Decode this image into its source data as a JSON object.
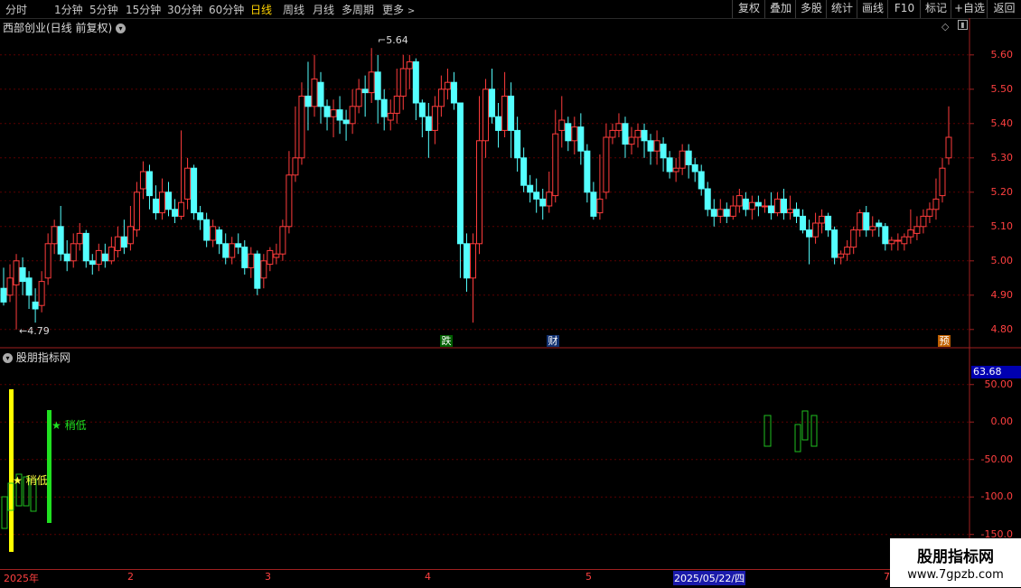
{
  "toolbar": {
    "periods": [
      "分时",
      "1分钟",
      "5分钟",
      "15分钟",
      "30分钟",
      "60分钟",
      "日线",
      "周线",
      "月线",
      "多周期",
      "更多"
    ],
    "active": "日线",
    "right_buttons": [
      "复权",
      "叠加",
      "多股",
      "统计",
      "画线",
      "F10",
      "标记",
      "+自选",
      "返回"
    ]
  },
  "main_pane": {
    "title": "西部创业(日线 前复权)",
    "price_axis": [
      "5.60",
      "5.50",
      "5.40",
      "5.30",
      "5.20",
      "5.10",
      "5.00",
      "4.90",
      "4.80"
    ],
    "high_label": "5.64",
    "low_label": "4.79",
    "event_tags": [
      {
        "text": "跌",
        "color": "#00a000"
      },
      {
        "text": "财",
        "color": "#2060d0"
      },
      {
        "text": "预",
        "color": "#e07000"
      }
    ]
  },
  "sub_pane": {
    "title": "股朋指标网",
    "current_value": "63.68",
    "axis": [
      "50.00",
      "0.00",
      "-50.00",
      "-100.0",
      "-150.0"
    ],
    "signal_label_1": "★ 稍低",
    "signal_label_2": "★ 稍低"
  },
  "date_axis": [
    "2025年",
    "2",
    "3",
    "4",
    "5",
    "2025/05/22/四",
    "7"
  ],
  "watermark": {
    "title": "股朋指标网",
    "url": "www.7gpzb.com"
  },
  "colors": {
    "up": "#ff3c3c",
    "down": "#54ffff",
    "grid": "#5a0000",
    "axis": "#a02020"
  },
  "chart_data": {
    "type": "candlestick",
    "symbol": "西部创业",
    "period": "日线",
    "ylim": [
      4.76,
      5.66
    ],
    "high_marker": 5.64,
    "low_marker": 4.79,
    "candles": [
      [
        4.92,
        4.88,
        4.98,
        4.87
      ],
      [
        4.9,
        4.95,
        4.99,
        4.88
      ],
      [
        4.93,
        5.0,
        5.02,
        4.8
      ],
      [
        4.98,
        4.94,
        5.01,
        4.9
      ],
      [
        4.95,
        4.9,
        4.97,
        4.86
      ],
      [
        4.88,
        4.86,
        4.92,
        4.82
      ],
      [
        4.87,
        4.94,
        4.97,
        4.85
      ],
      [
        4.95,
        5.05,
        5.08,
        4.93
      ],
      [
        5.05,
        5.1,
        5.12,
        5.02
      ],
      [
        5.1,
        5.02,
        5.16,
        5.0
      ],
      [
        5.02,
        5.0,
        5.06,
        4.97
      ],
      [
        5.0,
        5.05,
        5.08,
        4.98
      ],
      [
        5.05,
        5.08,
        5.11,
        5.03
      ],
      [
        5.08,
        5.0,
        5.09,
        4.98
      ],
      [
        5.0,
        4.99,
        5.02,
        4.96
      ],
      [
        4.99,
        5.03,
        5.05,
        4.97
      ],
      [
        5.02,
        5.0,
        5.05,
        4.98
      ],
      [
        5.0,
        5.04,
        5.07,
        4.99
      ],
      [
        5.03,
        5.07,
        5.1,
        5.01
      ],
      [
        5.07,
        5.04,
        5.12,
        5.02
      ],
      [
        5.05,
        5.1,
        5.16,
        5.03
      ],
      [
        5.09,
        5.2,
        5.23,
        5.07
      ],
      [
        5.21,
        5.26,
        5.29,
        5.18
      ],
      [
        5.26,
        5.19,
        5.28,
        5.15
      ],
      [
        5.18,
        5.14,
        5.22,
        5.12
      ],
      [
        5.14,
        5.2,
        5.24,
        5.12
      ],
      [
        5.2,
        5.15,
        5.23,
        5.13
      ],
      [
        5.15,
        5.13,
        5.18,
        5.11
      ],
      [
        5.13,
        5.17,
        5.38,
        5.12
      ],
      [
        5.18,
        5.27,
        5.3,
        5.15
      ],
      [
        5.27,
        5.14,
        5.28,
        5.12
      ],
      [
        5.14,
        5.12,
        5.16,
        5.09
      ],
      [
        5.12,
        5.06,
        5.14,
        5.04
      ],
      [
        5.06,
        5.1,
        5.12,
        5.04
      ],
      [
        5.09,
        5.05,
        5.1,
        5.02
      ],
      [
        5.05,
        5.01,
        5.08,
        4.99
      ],
      [
        5.01,
        5.05,
        5.07,
        4.99
      ],
      [
        5.05,
        5.04,
        5.08,
        5.02
      ],
      [
        5.04,
        4.98,
        5.06,
        4.96
      ],
      [
        4.98,
        5.02,
        5.04,
        4.95
      ],
      [
        5.02,
        4.92,
        5.03,
        4.9
      ],
      [
        4.95,
        5.0,
        5.02,
        4.92
      ],
      [
        4.99,
        5.03,
        5.04,
        4.97
      ],
      [
        5.01,
        5.02,
        5.05,
        4.99
      ],
      [
        5.02,
        5.1,
        5.12,
        5.0
      ],
      [
        5.1,
        5.25,
        5.32,
        5.08
      ],
      [
        5.25,
        5.3,
        5.45,
        5.23
      ],
      [
        5.3,
        5.48,
        5.52,
        5.28
      ],
      [
        5.48,
        5.45,
        5.58,
        5.38
      ],
      [
        5.45,
        5.53,
        5.6,
        5.42
      ],
      [
        5.52,
        5.45,
        5.55,
        5.4
      ],
      [
        5.45,
        5.42,
        5.47,
        5.38
      ],
      [
        5.42,
        5.44,
        5.47,
        5.36
      ],
      [
        5.44,
        5.41,
        5.48,
        5.37
      ],
      [
        5.41,
        5.4,
        5.44,
        5.35
      ],
      [
        5.4,
        5.45,
        5.5,
        5.37
      ],
      [
        5.45,
        5.5,
        5.53,
        5.43
      ],
      [
        5.5,
        5.49,
        5.54,
        5.42
      ],
      [
        5.49,
        5.55,
        5.62,
        5.46
      ],
      [
        5.55,
        5.47,
        5.6,
        5.4
      ],
      [
        5.47,
        5.42,
        5.5,
        5.38
      ],
      [
        5.41,
        5.43,
        5.47,
        5.38
      ],
      [
        5.43,
        5.48,
        5.56,
        5.4
      ],
      [
        5.48,
        5.56,
        5.6,
        5.44
      ],
      [
        5.56,
        5.58,
        5.6,
        5.5
      ],
      [
        5.58,
        5.46,
        5.59,
        5.41
      ],
      [
        5.46,
        5.42,
        5.47,
        5.36
      ],
      [
        5.42,
        5.38,
        5.46,
        5.3
      ],
      [
        5.38,
        5.45,
        5.48,
        5.34
      ],
      [
        5.45,
        5.5,
        5.54,
        5.42
      ],
      [
        5.5,
        5.52,
        5.56,
        5.47
      ],
      [
        5.52,
        5.46,
        5.55,
        5.44
      ],
      [
        5.46,
        5.05,
        5.2,
        4.95
      ],
      [
        5.05,
        4.95,
        5.08,
        4.91
      ],
      [
        4.95,
        5.05,
        5.08,
        4.82
      ],
      [
        5.05,
        5.35,
        5.48,
        5.02
      ],
      [
        5.35,
        5.5,
        5.53,
        5.3
      ],
      [
        5.5,
        5.42,
        5.56,
        5.4
      ],
      [
        5.42,
        5.38,
        5.46,
        5.33
      ],
      [
        5.38,
        5.48,
        5.55,
        5.36
      ],
      [
        5.48,
        5.38,
        5.52,
        5.3
      ],
      [
        5.38,
        5.3,
        5.42,
        5.26
      ],
      [
        5.3,
        5.22,
        5.33,
        5.2
      ],
      [
        5.22,
        5.2,
        5.25,
        5.17
      ],
      [
        5.2,
        5.18,
        5.24,
        5.14
      ],
      [
        5.18,
        5.16,
        5.21,
        5.12
      ],
      [
        5.16,
        5.2,
        5.26,
        5.14
      ],
      [
        5.19,
        5.37,
        5.44,
        5.17
      ],
      [
        5.38,
        5.41,
        5.48,
        5.33
      ],
      [
        5.4,
        5.35,
        5.42,
        5.32
      ],
      [
        5.35,
        5.39,
        5.42,
        5.31
      ],
      [
        5.39,
        5.32,
        5.43,
        5.28
      ],
      [
        5.32,
        5.2,
        5.34,
        5.17
      ],
      [
        5.2,
        5.13,
        5.23,
        5.12
      ],
      [
        5.14,
        5.18,
        5.31,
        5.12
      ],
      [
        5.2,
        5.36,
        5.4,
        5.18
      ],
      [
        5.36,
        5.38,
        5.4,
        5.34
      ],
      [
        5.38,
        5.4,
        5.43,
        5.36
      ],
      [
        5.4,
        5.34,
        5.42,
        5.3
      ],
      [
        5.34,
        5.36,
        5.39,
        5.31
      ],
      [
        5.36,
        5.38,
        5.4,
        5.33
      ],
      [
        5.38,
        5.35,
        5.4,
        5.3
      ],
      [
        5.35,
        5.32,
        5.37,
        5.28
      ],
      [
        5.32,
        5.35,
        5.38,
        5.28
      ],
      [
        5.34,
        5.3,
        5.36,
        5.26
      ],
      [
        5.3,
        5.26,
        5.32,
        5.24
      ],
      [
        5.26,
        5.27,
        5.3,
        5.23
      ],
      [
        5.27,
        5.32,
        5.34,
        5.25
      ],
      [
        5.32,
        5.28,
        5.34,
        5.24
      ],
      [
        5.28,
        5.26,
        5.3,
        5.23
      ],
      [
        5.26,
        5.21,
        5.28,
        5.19
      ],
      [
        5.21,
        5.15,
        5.23,
        5.13
      ],
      [
        5.15,
        5.13,
        5.18,
        5.1
      ],
      [
        5.13,
        5.15,
        5.18,
        5.11
      ],
      [
        5.15,
        5.13,
        5.17,
        5.11
      ],
      [
        5.13,
        5.16,
        5.19,
        5.12
      ],
      [
        5.16,
        5.19,
        5.21,
        5.14
      ],
      [
        5.18,
        5.15,
        5.2,
        5.13
      ],
      [
        5.15,
        5.17,
        5.19,
        5.12
      ],
      [
        5.17,
        5.16,
        5.19,
        5.13
      ],
      [
        5.16,
        5.16,
        5.18,
        5.14
      ],
      [
        5.16,
        5.14,
        5.2,
        5.12
      ],
      [
        5.14,
        5.18,
        5.2,
        5.13
      ],
      [
        5.18,
        5.14,
        5.21,
        5.12
      ],
      [
        5.14,
        5.15,
        5.19,
        5.12
      ],
      [
        5.15,
        5.13,
        5.17,
        5.11
      ],
      [
        5.13,
        5.09,
        5.15,
        5.08
      ],
      [
        5.09,
        5.07,
        5.12,
        4.99
      ],
      [
        5.07,
        5.11,
        5.14,
        5.05
      ],
      [
        5.11,
        5.13,
        5.15,
        5.08
      ],
      [
        5.13,
        5.09,
        5.14,
        5.07
      ],
      [
        5.09,
        5.01,
        5.1,
        4.99
      ],
      [
        5.01,
        5.02,
        5.03,
        4.99
      ],
      [
        5.02,
        5.04,
        5.06,
        5.0
      ],
      [
        5.04,
        5.09,
        5.1,
        5.02
      ],
      [
        5.09,
        5.14,
        5.15,
        5.07
      ],
      [
        5.14,
        5.09,
        5.16,
        5.07
      ],
      [
        5.09,
        5.1,
        5.13,
        5.07
      ],
      [
        5.11,
        5.1,
        5.12,
        5.07
      ],
      [
        5.1,
        5.05,
        5.11,
        5.03
      ],
      [
        5.05,
        5.06,
        5.07,
        5.03
      ],
      [
        5.06,
        5.06,
        5.08,
        5.03
      ],
      [
        5.05,
        5.07,
        5.08,
        5.03
      ],
      [
        5.07,
        5.09,
        5.15,
        5.05
      ],
      [
        5.08,
        5.1,
        5.13,
        5.06
      ],
      [
        5.1,
        5.13,
        5.15,
        5.08
      ],
      [
        5.13,
        5.15,
        5.17,
        5.11
      ],
      [
        5.15,
        5.18,
        5.24,
        5.12
      ],
      [
        5.19,
        5.27,
        5.3,
        5.17
      ],
      [
        5.3,
        5.36,
        5.45,
        5.28
      ]
    ]
  }
}
